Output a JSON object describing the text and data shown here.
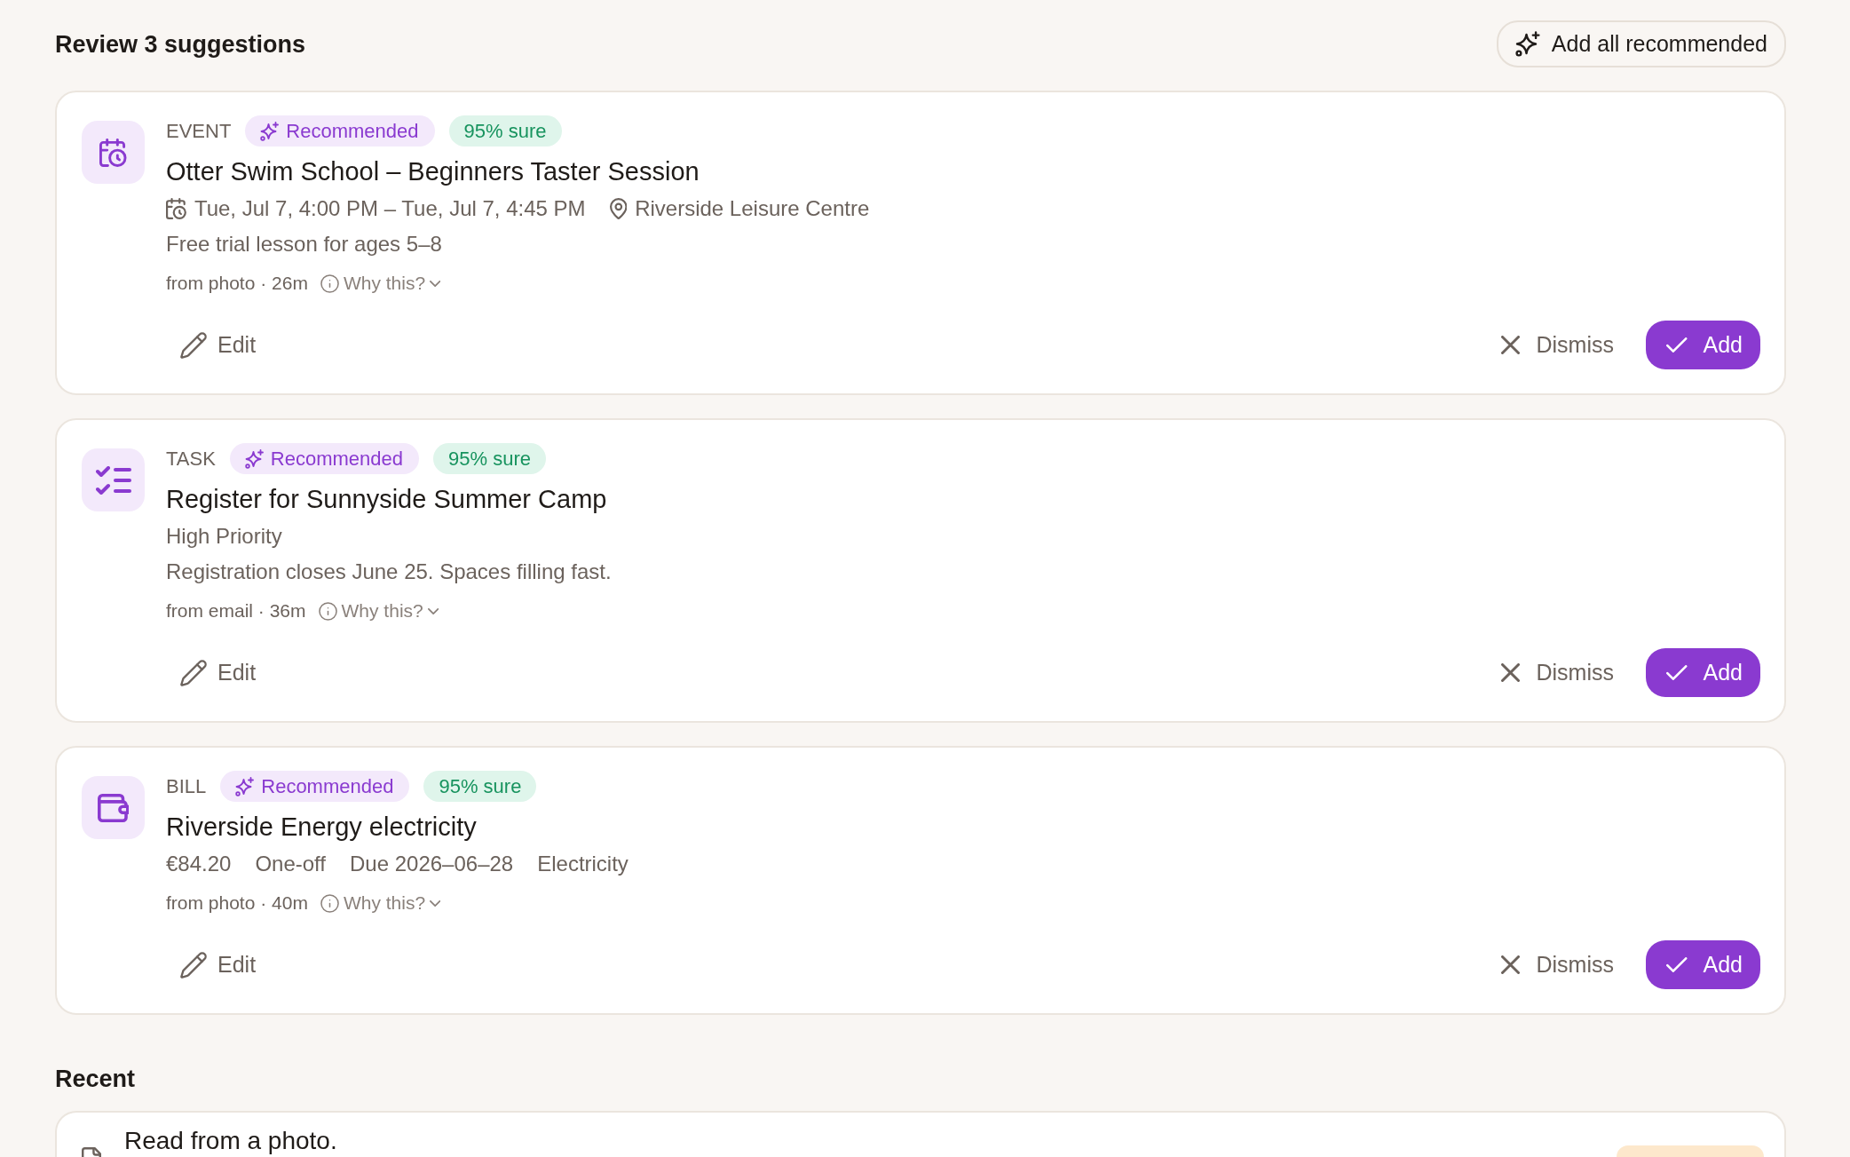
{
  "header": {
    "title": "Review 3 suggestions",
    "action": "Add all recommended"
  },
  "suggestions": [
    {
      "kind": "event",
      "type_label": "EVENT",
      "tags": [
        {
          "kind": "recommended",
          "label": "Recommended"
        },
        {
          "kind": "confidence",
          "label": "95% sure"
        }
      ],
      "title": "Otter Swim School – Beginners Taster Session",
      "rows": [
        {
          "parts": [
            {
              "kind": "datetime",
              "text": "Tue, Jul 7, 4:00 PM – Tue, Jul 7, 4:45 PM"
            },
            {
              "kind": "location",
              "text": "Riverside Leisure Centre"
            }
          ]
        },
        {
          "parts": [
            {
              "kind": "plain",
              "text": "Free trial lesson for ages 5–8"
            }
          ]
        }
      ],
      "source": "from photo · 26m",
      "why": "Why this?",
      "actions": {
        "edit": "Edit",
        "dismiss": "Dismiss",
        "add": "Add"
      }
    },
    {
      "kind": "task",
      "type_label": "TASK",
      "tags": [
        {
          "kind": "recommended",
          "label": "Recommended"
        },
        {
          "kind": "confidence",
          "label": "95% sure"
        }
      ],
      "title": "Register for Sunnyside Summer Camp",
      "rows": [
        {
          "parts": [
            {
              "kind": "plain",
              "text": "High Priority"
            }
          ]
        },
        {
          "parts": [
            {
              "kind": "plain",
              "text": "Registration closes June 25. Spaces filling fast."
            }
          ]
        }
      ],
      "source": "from email · 36m",
      "why": "Why this?",
      "actions": {
        "edit": "Edit",
        "dismiss": "Dismiss",
        "add": "Add"
      }
    },
    {
      "kind": "bill",
      "type_label": "BILL",
      "tags": [
        {
          "kind": "recommended",
          "label": "Recommended"
        },
        {
          "kind": "confidence",
          "label": "95% sure"
        }
      ],
      "title": "Riverside Energy electricity",
      "rows": [
        {
          "parts": [
            {
              "kind": "plain",
              "text": "€84.20"
            },
            {
              "kind": "plain",
              "text": "One-off"
            },
            {
              "kind": "plain",
              "text": "Due 2026–06–28"
            },
            {
              "kind": "plain",
              "text": "Electricity"
            }
          ]
        }
      ],
      "source": "from photo · 40m",
      "why": "Why this?",
      "actions": {
        "edit": "Edit",
        "dismiss": "Dismiss",
        "add": "Add"
      }
    }
  ],
  "recent": {
    "title": "Recent",
    "items": [
      {
        "kind": "document",
        "text": "Read from a photo.",
        "badge": true
      }
    ]
  }
}
